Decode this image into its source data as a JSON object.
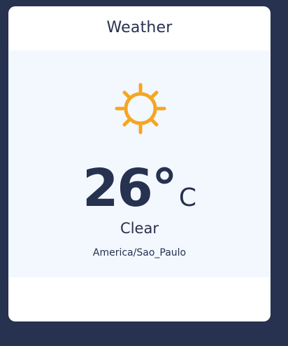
{
  "widget": {
    "title": "Weather",
    "icon": "sun-icon",
    "temperature": "26°",
    "unit": "C",
    "condition": "Clear",
    "timezone": "America/Sao_Paulo"
  },
  "colors": {
    "background": "#273150",
    "card": "#ffffff",
    "panel": "#f3f8fe",
    "text": "#273150",
    "sun": "#f5a623"
  }
}
